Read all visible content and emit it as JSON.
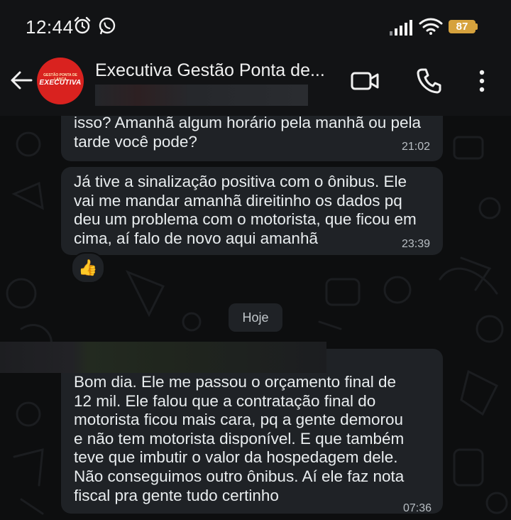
{
  "status_bar": {
    "time": "12:44",
    "battery": "87",
    "icons": [
      "alarm-icon",
      "whatsapp-icon",
      "signal-icon",
      "wifi-icon",
      "battery-icon"
    ]
  },
  "header": {
    "contact_name": "Executiva Gestão Ponta de...",
    "avatar": {
      "tagline": "GESTÃO PONTA DE LANÇA",
      "brand": "EXECUTIVA",
      "color": "#d9221f"
    },
    "icons": [
      "back-arrow-icon",
      "video-call-icon",
      "phone-call-icon",
      "more-options-icon"
    ]
  },
  "messages": [
    {
      "text": "isso? Amanhã algum horário pela manhã ou pela\ntarde você pode?",
      "time": "21:02"
    },
    {
      "text": "Já tive a sinalização positiva com o ônibus. Ele\nvai me mandar amanhã direitinho os dados pq\ndeu um problema com o motorista, que ficou em\ncima, aí falo de novo aqui amanhã",
      "time": "23:39",
      "reaction": "👍"
    },
    {
      "text": "Bom dia. Ele me passou o orçamento final de\n12 mil. Ele falou que a contratação final do\nmotorista ficou mais cara, pq a gente demorou\ne não tem motorista disponível. E que também\nteve que imbutir o valor da hospedagem dele.\nNão conseguimos outro ônibus. Aí ele faz nota\nfiscal pra gente tudo certinho",
      "time": "07:36"
    }
  ],
  "day_divider": "Hoje",
  "colors": {
    "background": "#0d0e0f",
    "bubble": "#1f2226",
    "battery": "#d6a23d"
  }
}
